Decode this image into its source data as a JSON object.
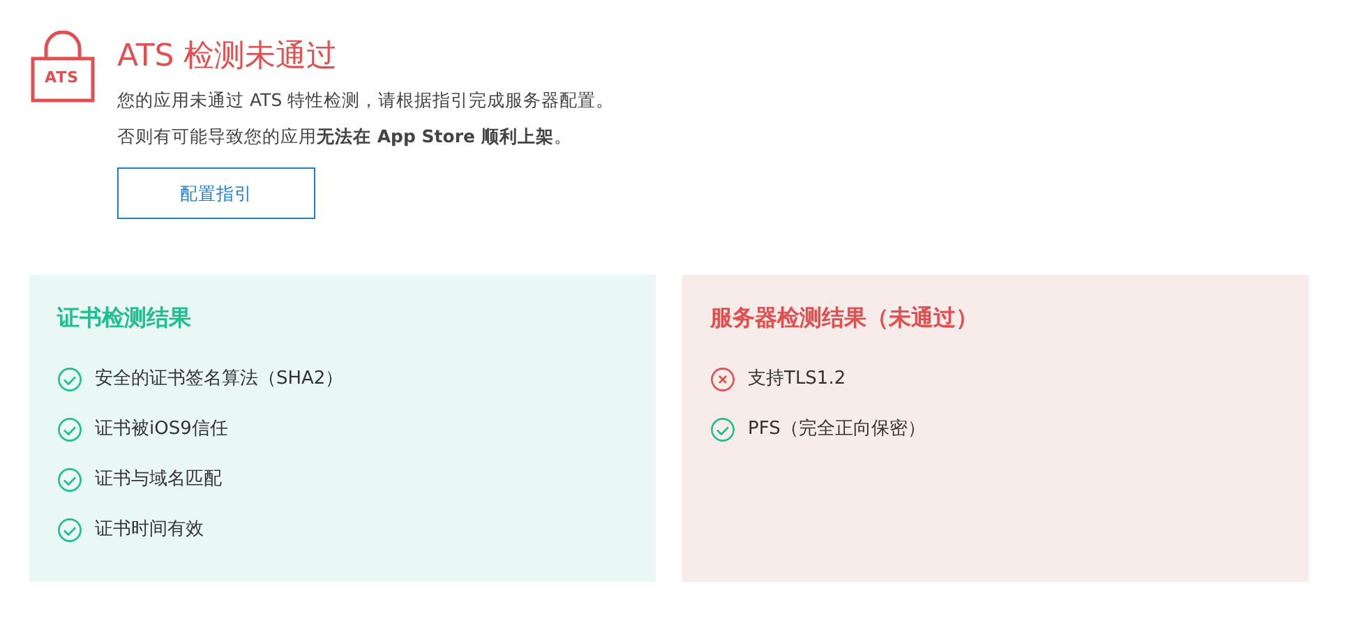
{
  "header": {
    "lock_label": "ATS",
    "title": "ATS 检测未通过",
    "lines": [
      "您的应用未通过 ATS 特性检测，请根据指引完成服务器配置。",
      "否则有可能导致您的应用**无法在 App Store 顺利上架**。"
    ],
    "button": "配置指引"
  },
  "panels": [
    {
      "title": "证书检测结果",
      "passed": true,
      "items": [
        {
          "label": "安全的证书签名算法（SHA2）",
          "passed": true
        },
        {
          "label": "证书被iOS9信任",
          "passed": true
        },
        {
          "label": "证书与域名匹配",
          "passed": true
        },
        {
          "label": "证书时间有效",
          "passed": true
        }
      ]
    },
    {
      "title": "服务器检测结果（未通过）",
      "passed": false,
      "items": [
        {
          "label": "支持TLS1.2",
          "passed": false
        },
        {
          "label": "PFS（完全正向保密）",
          "passed": true
        }
      ]
    }
  ]
}
